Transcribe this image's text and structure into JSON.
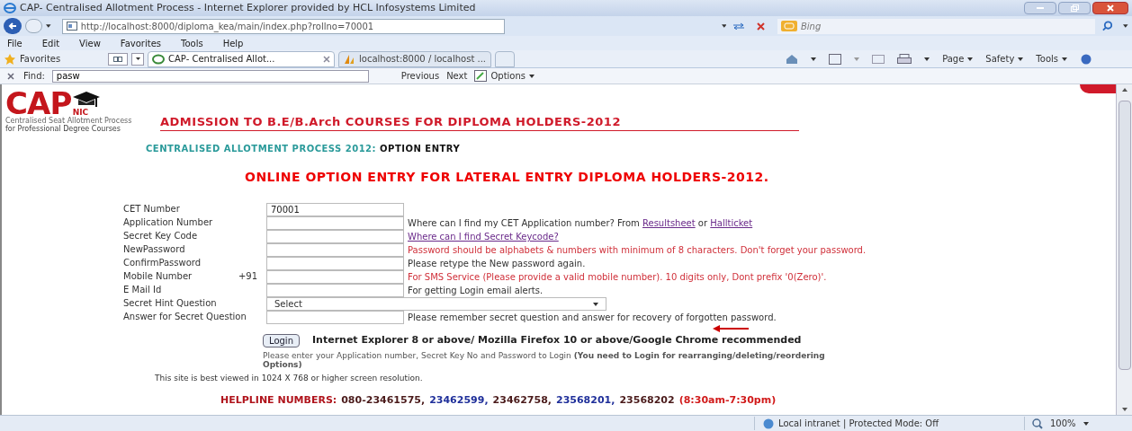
{
  "window": {
    "title": "CAP- Centralised Allotment Process - Internet Explorer provided by HCL Infosystems Limited"
  },
  "address_bar": {
    "url": "http://localhost:8000/diploma_kea/main/index.php?rollno=70001",
    "search_placeholder": "Bing"
  },
  "menu": [
    "File",
    "Edit",
    "View",
    "Favorites",
    "Tools",
    "Help"
  ],
  "favorites_bar": {
    "label": "Favorites",
    "tabs": [
      {
        "label": "CAP- Centralised Allot...",
        "selected": true
      },
      {
        "label": "localhost:8000 / localhost ...",
        "selected": false
      }
    ],
    "commands": [
      "Page",
      "Safety",
      "Tools"
    ]
  },
  "find_bar": {
    "label": "Find:",
    "value": "pasw",
    "buttons": [
      "Previous",
      "Next",
      "Options"
    ]
  },
  "page": {
    "logo": {
      "title": "CAP",
      "badge": "NIC",
      "tagline": "Centralised Seat Allotment Process",
      "tagline_2": "for Professional Degree Courses"
    },
    "heading": "ADMISSION TO B.E/B.Arch COURSES FOR DIPLOMA HOLDERS-2012",
    "subheading": {
      "prefix": "CENTRALISED ALLOTMENT PROCESS 2012:",
      "suffix": "OPTION ENTRY"
    },
    "main_heading": "ONLINE OPTION ENTRY FOR LATERAL ENTRY DIPLOMA HOLDERS-2012.",
    "form": [
      {
        "label": "CET Number",
        "kind": "text",
        "value": "70001"
      },
      {
        "label": "Application Number",
        "kind": "text",
        "help": [
          {
            "kind": "plain",
            "text": "Where can I find my CET Application number? From "
          },
          {
            "kind": "link",
            "text": "Resultsheet"
          },
          {
            "kind": "plain",
            "text": " or "
          },
          {
            "kind": "link",
            "text": "Hallticket"
          }
        ]
      },
      {
        "label": "Secret Key Code",
        "kind": "text",
        "help": [
          {
            "kind": "link",
            "text": "Where can I find Secret Keycode?"
          }
        ]
      },
      {
        "label": "NewPassword",
        "kind": "text",
        "help": [
          {
            "kind": "warning",
            "text": "Password should be alphabets & numbers with minimum of 8 characters. Don't forget your password."
          }
        ]
      },
      {
        "label": "ConfirmPassword",
        "kind": "text",
        "help": [
          {
            "kind": "plain",
            "text": "Please retype the New password again."
          }
        ]
      },
      {
        "label": "Mobile Number",
        "prefix": "+91",
        "kind": "text",
        "help": [
          {
            "kind": "warning",
            "text": "For SMS Service (Please provide a valid mobile number). 10 digits only, Dont prefix '0(Zero)'."
          }
        ]
      },
      {
        "label": "E Mail Id",
        "kind": "text",
        "help": [
          {
            "kind": "plain",
            "text": "For getting Login email alerts."
          }
        ]
      },
      {
        "label": "Secret Hint Question",
        "kind": "select",
        "value": "Select"
      },
      {
        "label": "Answer for Secret Question",
        "kind": "text",
        "help": [
          {
            "kind": "plain",
            "text": "Please remember secret question and answer for recovery of forgotten password."
          }
        ]
      }
    ],
    "login_button": "Login",
    "browser_note": "Internet Explorer 8 or above/ Mozilla Firefox 10 or above/Google Chrome recommended",
    "login_note": "Please enter your Application number, Secret Key No and Password to Login **(You need to Login for rearranging/deleting/reordering Options)**",
    "resolution_note": "This site is best viewed in 1024 X 768 or higher screen resolution.",
    "helpline": {
      "label": "HELPLINE NUMBERS:",
      "numbers": [
        {
          "text": "080-23461575,",
          "color": "#4a1a1a"
        },
        {
          "text": "23462599,",
          "color": "#1f2f9a"
        },
        {
          "text": "23462758,",
          "color": "#4a1a1a"
        },
        {
          "text": "23568201,",
          "color": "#1f2f9a"
        },
        {
          "text": "23568202",
          "color": "#4a1a1a"
        },
        {
          "text": "(8:30am-7:30pm)",
          "color": "#d11a1a"
        }
      ]
    }
  },
  "status_bar": {
    "zone": "Local intranet | Protected Mode: Off",
    "zoom": "100%"
  }
}
